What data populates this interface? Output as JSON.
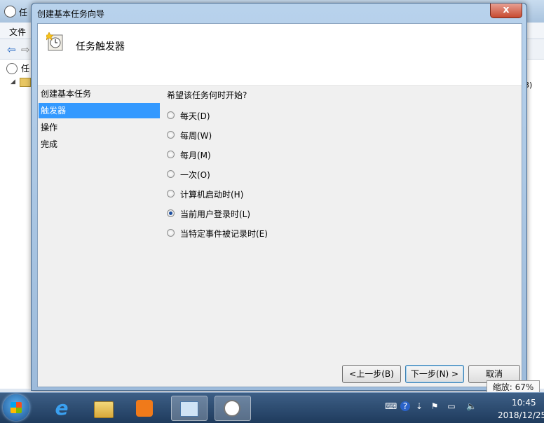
{
  "background_app": {
    "title": "任",
    "menu_file": "文件",
    "tree_item": "任",
    "right_panel_label": "3)"
  },
  "dialog": {
    "title": "创建基本任务向导",
    "close_glyph": "x",
    "header_title": "任务触发器",
    "nav_items": [
      "创建基本任务",
      "触发器",
      "操作",
      "完成"
    ],
    "selected_nav": 1,
    "question": "希望该任务何时开始?",
    "options": [
      "每天(D)",
      "每周(W)",
      "每月(M)",
      "一次(O)",
      "计算机启动时(H)",
      "当前用户登录时(L)",
      "当特定事件被记录时(E)"
    ],
    "selected_option": 5,
    "buttons": {
      "back": "<上一步(B)",
      "next": "下一步(N) >",
      "cancel": "取消"
    }
  },
  "taskbar": {
    "time": "10:45",
    "date": "2018/12/25",
    "zoom": "缩放: 67%"
  }
}
